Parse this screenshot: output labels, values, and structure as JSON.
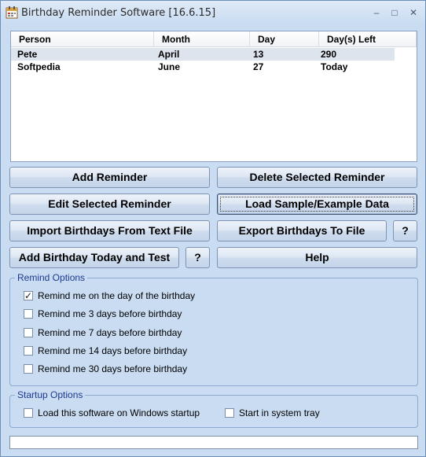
{
  "window": {
    "title": "Birthday Reminder Software [16.6.15]",
    "minimize": "–",
    "maximize": "□",
    "close": "✕"
  },
  "list": {
    "columns": [
      "Person",
      "Month",
      "Day",
      "Day(s) Left"
    ],
    "rows": [
      {
        "person": "Pete",
        "month": "April",
        "day": "13",
        "left": "290"
      },
      {
        "person": "Softpedia",
        "month": "June",
        "day": "27",
        "left": "Today"
      }
    ]
  },
  "buttons": {
    "add_reminder": "Add Reminder",
    "delete_reminder": "Delete Selected Reminder",
    "edit_reminder": "Edit Selected Reminder",
    "load_sample": "Load Sample/Example Data",
    "import": "Import Birthdays From Text File",
    "export": "Export Birthdays To File",
    "help_q1": "?",
    "add_today": "Add Birthday Today and Test",
    "help_q2": "?",
    "help": "Help"
  },
  "remind_options": {
    "title": "Remind Options",
    "items": [
      {
        "label": "Remind me on the day of the birthday",
        "checked": true
      },
      {
        "label": "Remind me 3 days before birthday",
        "checked": false
      },
      {
        "label": "Remind me 7 days before birthday",
        "checked": false
      },
      {
        "label": "Remind me 14 days before birthday",
        "checked": false
      },
      {
        "label": "Remind me 30 days before birthday",
        "checked": false
      }
    ]
  },
  "startup_options": {
    "title": "Startup Options",
    "items": [
      {
        "label": "Load this software on Windows startup",
        "checked": false
      },
      {
        "label": "Start in system tray",
        "checked": false
      }
    ]
  },
  "status": {
    "text": ""
  }
}
